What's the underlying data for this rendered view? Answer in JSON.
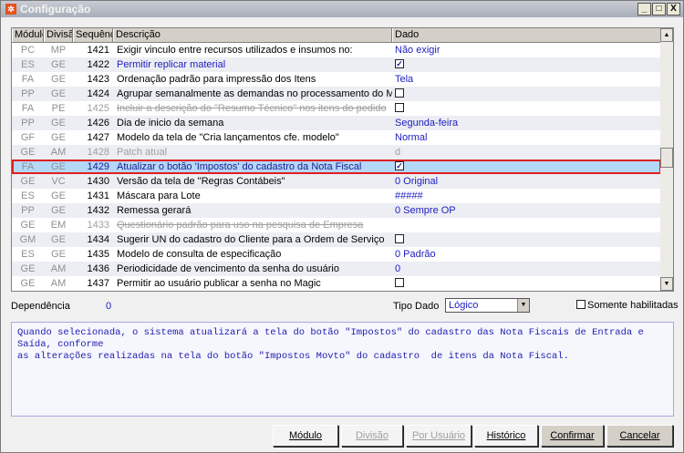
{
  "window": {
    "title": "Configuração",
    "minimize": "_",
    "maximize": "□",
    "close": "X"
  },
  "grid": {
    "columns": [
      "Módulo",
      "Divisão",
      "Sequência",
      "Descrição",
      "Dado"
    ],
    "rows": [
      {
        "modulo": "PC",
        "divisao": "MP",
        "seq": "1421",
        "desc": "Exigir vinculo entre recursos utilizados e insumos no:",
        "dado": "Não exigir",
        "type": "text"
      },
      {
        "modulo": "ES",
        "divisao": "GE",
        "seq": "1422",
        "desc": "Permitir replicar material",
        "dado": "checked",
        "type": "check",
        "style": "blue"
      },
      {
        "modulo": "FA",
        "divisao": "GE",
        "seq": "1423",
        "desc": "Ordenação padrão para impressão dos Itens",
        "dado": "Tela",
        "type": "text"
      },
      {
        "modulo": "PP",
        "divisao": "GE",
        "seq": "1424",
        "desc": "Agrupar semanalmente as demandas no processamento do MRP",
        "dado": "unchecked",
        "type": "check"
      },
      {
        "modulo": "FA",
        "divisao": "PE",
        "seq": "1425",
        "desc": "Incluir a descrição do \"Resumo Técnico\" nos itens do pedido",
        "dado": "unchecked",
        "type": "check",
        "style": "strike"
      },
      {
        "modulo": "PP",
        "divisao": "GE",
        "seq": "1426",
        "desc": "Dia de inicio da semana",
        "dado": "Segunda-feira",
        "type": "text"
      },
      {
        "modulo": "GF",
        "divisao": "GE",
        "seq": "1427",
        "desc": "Modelo da tela de \"Cria lançamentos cfe. modelo\"",
        "dado": "Normal",
        "type": "text"
      },
      {
        "modulo": "GE",
        "divisao": "AM",
        "seq": "1428",
        "desc": "Patch atual",
        "dado": "d",
        "type": "text",
        "style": "dis"
      },
      {
        "modulo": "FA",
        "divisao": "GE",
        "seq": "1429",
        "desc": "Atualizar o botão 'Impostos' do cadastro da Nota Fiscal",
        "dado": "checked",
        "type": "check",
        "style": "sel"
      },
      {
        "modulo": "GE",
        "divisao": "VC",
        "seq": "1430",
        "desc": "Versão da tela de \"Regras Contábeis\"",
        "dado": "0 Original",
        "type": "text"
      },
      {
        "modulo": "ES",
        "divisao": "GE",
        "seq": "1431",
        "desc": "Máscara para Lote",
        "dado": "#####",
        "type": "text"
      },
      {
        "modulo": "PP",
        "divisao": "GE",
        "seq": "1432",
        "desc": "Remessa gerará",
        "dado": "0 Sempre OP",
        "type": "text"
      },
      {
        "modulo": "GE",
        "divisao": "EM",
        "seq": "1433",
        "desc": "Questionário padrão para uso na pesquisa de Empresa",
        "dado": "",
        "type": "text",
        "style": "strike"
      },
      {
        "modulo": "GM",
        "divisao": "GE",
        "seq": "1434",
        "desc": "Sugerir UN do cadastro do Cliente para a Ordem de Serviço",
        "dado": "unchecked",
        "type": "check"
      },
      {
        "modulo": "ES",
        "divisao": "GE",
        "seq": "1435",
        "desc": "Modelo de consulta de especificação",
        "dado": "0 Padrão",
        "type": "text"
      },
      {
        "modulo": "GE",
        "divisao": "AM",
        "seq": "1436",
        "desc": "Periodicidade de vencimento da senha do usuário",
        "dado": "0",
        "type": "text"
      },
      {
        "modulo": "GE",
        "divisao": "AM",
        "seq": "1437",
        "desc": "Permitir ao usuário publicar a senha no Magic",
        "dado": "unchecked",
        "type": "check"
      }
    ]
  },
  "footer": {
    "dependencia_label": "Dependência",
    "dependencia_value": "0",
    "tipo_dado_label": "Tipo Dado",
    "tipo_dado_value": "Lógico",
    "somente_habilitadas": "Somente habilitadas",
    "description": "Quando selecionada, o sistema atualizará a tela do botão \"Impostos\" do cadastro das Nota Fiscais de Entrada e Saída, conforme\nas alterações realizadas na tela do botão \"Impostos Movto\" do cadastro  de itens da Nota Fiscal."
  },
  "buttons": {
    "modulo": "Módulo",
    "divisao": "Divisão",
    "por_usuario": "Por Usuário",
    "historico": "Histórico",
    "confirmar": "Confirmar",
    "cancelar": "Cancelar"
  }
}
